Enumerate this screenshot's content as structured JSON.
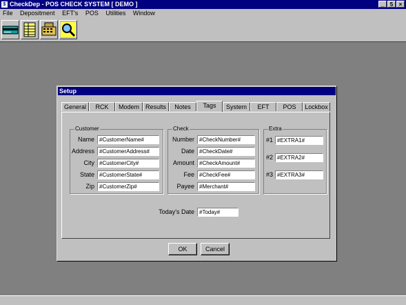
{
  "window": {
    "title": "CheckDep - POS CHECK SYSTEM [ DEMO ]",
    "icon": "$",
    "controls": [
      "_",
      "5",
      "×"
    ]
  },
  "menu": [
    "File",
    "Depositment",
    "EFT's",
    "POS",
    "Utilities",
    "Window"
  ],
  "toolbar": {
    "buttons": [
      "card-icon",
      "ledger-icon",
      "cash-register-icon",
      "magnifier-icon"
    ]
  },
  "dialog": {
    "title": "Setup",
    "tabs": [
      "General",
      "RCK",
      "Modem",
      "Results",
      "Notes",
      "Tags",
      "System",
      "EFT",
      "POS",
      "Lockbox"
    ],
    "active_tab": "Tags",
    "customer": {
      "label": "Customer",
      "fields": [
        {
          "label": "Name",
          "value": "#CustomerName#"
        },
        {
          "label": "Address",
          "value": "#CustomerAddress#"
        },
        {
          "label": "City",
          "value": "#CustomerCity#"
        },
        {
          "label": "State",
          "value": "#CustomerState#"
        },
        {
          "label": "Zip",
          "value": "#CustomerZip#"
        }
      ]
    },
    "check": {
      "label": "Check",
      "fields": [
        {
          "label": "Number",
          "value": "#CheckNumber#"
        },
        {
          "label": "Date",
          "value": "#CheckDate#"
        },
        {
          "label": "Amount",
          "value": "#CheckAmount#"
        },
        {
          "label": "Fee",
          "value": "#CheckFee#"
        },
        {
          "label": "Payee",
          "value": "#Merchant#"
        }
      ]
    },
    "extra": {
      "label": "Extra",
      "fields": [
        {
          "label": "#1",
          "value": "#EXTRA1#"
        },
        {
          "label": "#2",
          "value": "#EXTRA2#"
        },
        {
          "label": "#3",
          "value": "#EXTRA3#"
        }
      ]
    },
    "today": {
      "label": "Today's Date",
      "value": "#Today#"
    },
    "ok_label": "OK",
    "cancel_label": "Cancel"
  }
}
